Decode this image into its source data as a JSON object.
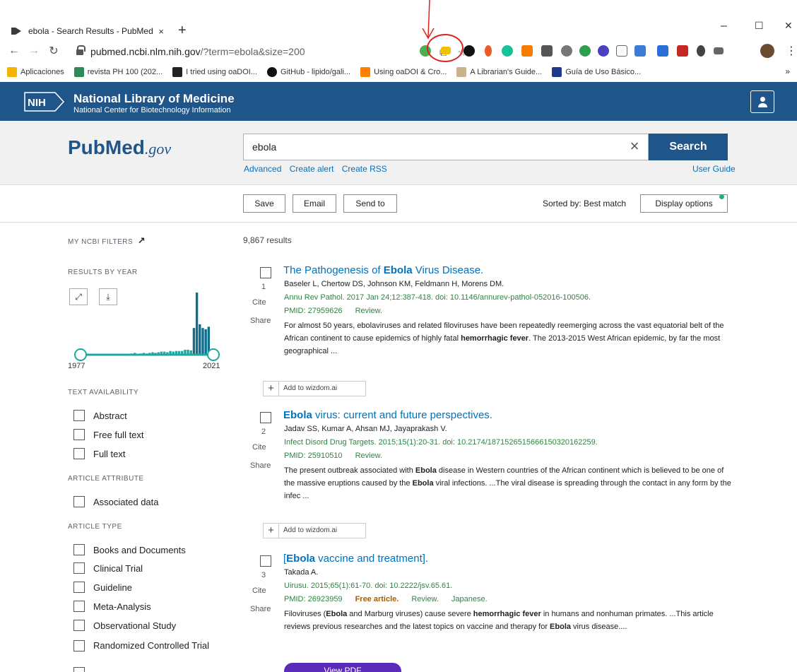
{
  "browser": {
    "tab_title": "ebola - Search Results - PubMed",
    "tab_close": "×",
    "new_tab": "+",
    "win_min": "–",
    "win_max": "☐",
    "win_close": "✕",
    "url_host": "pubmed.ncbi.nlm.nih.gov",
    "url_rest": "/?term=ebola&size=200",
    "back": "←",
    "forward": "→",
    "reload": "↻",
    "omni_translate": "⧉",
    "omni_star": "☆",
    "kebab": "⋮",
    "bookmarks": [
      {
        "label": "Aplicaciones",
        "color": "#f4b400"
      },
      {
        "label": "revista PH 100 (202...",
        "color": "#2e8b57"
      },
      {
        "label": "I tried using oaDOI...",
        "color": "#222222"
      },
      {
        "label": "GitHub - lipido/gali...",
        "color": "#111111"
      },
      {
        "label": "Using oaDOI & Cro...",
        "color": "#ff7f00"
      },
      {
        "label": "A Librarian's Guide...",
        "color": "#c9b38a"
      },
      {
        "label": "Guía de Uso Básico...",
        "color": "#1e3a8a"
      }
    ],
    "bookmarks_more": "»"
  },
  "nih": {
    "logo": "NIH",
    "title": "National Library of Medicine",
    "subtitle": "National Center for Biotechnology Information"
  },
  "search": {
    "logo_main": "PubMed",
    "logo_gov": ".gov",
    "query": "ebola",
    "clear": "×",
    "button": "Search",
    "links": [
      "Advanced",
      "Create alert",
      "Create RSS"
    ],
    "user_guide": "User Guide"
  },
  "actions": {
    "save": "Save",
    "email": "Email",
    "send_to": "Send to",
    "sorted": "Sorted by: Best match",
    "display": "Display options"
  },
  "sidebar": {
    "my_ncbi": "MY NCBI FILTERS",
    "my_ncbi_icon": "↗",
    "results_by_year": "RESULTS BY YEAR",
    "expand_icon": "⤢",
    "download_icon": "⤓",
    "year_start": "1977",
    "year_end": "2021",
    "text_availability": "TEXT AVAILABILITY",
    "text_filters": [
      "Abstract",
      "Free full text",
      "Full text"
    ],
    "article_attribute": "ARTICLE ATTRIBUTE",
    "attr_filters": [
      "Associated data"
    ],
    "article_type": "ARTICLE TYPE",
    "type_filters": [
      "Books and Documents",
      "Clinical Trial",
      "Guideline",
      "Meta-Analysis",
      "Observational Study",
      "Randomized Controlled Trial"
    ]
  },
  "results": {
    "count": "9,867 results",
    "cite": "Cite",
    "share": "Share",
    "wizdom": "Add to wizdom.ai",
    "wizdom_plus": "+",
    "items": [
      {
        "num": "1",
        "title_pre": "The Pathogenesis of ",
        "title_bold": "Ebola",
        "title_post": " Virus Disease.",
        "authors": "Baseler L, Chertow DS, Johnson KM, Feldmann H, Morens DM.",
        "citation": "Annu Rev Pathol. 2017 Jan 24;12:387-418. doi: 10.1146/annurev-pathol-052016-100506.",
        "pmid": "PMID: 27959626",
        "free": "",
        "type": "Review.",
        "lang": "",
        "snip1": "For almost 50 years, ebolaviruses and related filoviruses have been repeatedly reemerging across the vast equatorial belt of the African continent to cause epidemics of highly fatal ",
        "snip1b": "hemorrhagic fever",
        "snip1c": ". The 2013-2015 West African epidemic, by far the most geographical ..."
      },
      {
        "num": "2",
        "title_pre": "",
        "title_bold": "Ebola",
        "title_post": " virus: current and future perspectives.",
        "authors": "Jadav SS, Kumar A, Ahsan MJ, Jayaprakash V.",
        "citation": "Infect Disord Drug Targets. 2015;15(1):20-31. doi: 10.2174/1871526515666150320162259.",
        "pmid": "PMID: 25910510",
        "free": "",
        "type": "Review.",
        "lang": "",
        "snip_a": "The present outbreak associated with ",
        "snip_b": "Ebola",
        "snip_c": " disease in Western countries of the African continent which is believed to be one of the massive eruptions caused by the ",
        "snip_d": "Ebola",
        "snip_e": " viral infections. ...The viral disease is spreading through the contact in any form by the infec ..."
      },
      {
        "num": "3",
        "title_pre": "[",
        "title_bold": "Ebola",
        "title_post": " vaccine and treatment].",
        "authors": "Takada A.",
        "citation": "Uirusu. 2015;65(1):61-70. doi: 10.2222/jsv.65.61.",
        "pmid": "PMID: 26923959",
        "free": "Free article.",
        "type": "Review.",
        "lang": "Japanese.",
        "s1": "Filoviruses (",
        "s2": "Ebola",
        "s3": " and Marburg viruses) cause severe ",
        "s4": "hemorrhagic fever",
        "s5": " in humans and nonhuman primates. ...This article reviews previous researches and the latest topics on vaccine and therapy for ",
        "s6": "Ebola",
        "s7": " virus disease...."
      }
    ],
    "view_pdf": "View PDF"
  },
  "chart_data": {
    "type": "bar",
    "xlim": [
      1977,
      2021
    ],
    "values": [
      0,
      0,
      0,
      1,
      0,
      0,
      0,
      0,
      0,
      0,
      0,
      1,
      0,
      1,
      0,
      1,
      1,
      2,
      3,
      1,
      2,
      3,
      2,
      3,
      4,
      3,
      4,
      5,
      5,
      4,
      6,
      5,
      6,
      6,
      6,
      8,
      8,
      7,
      43,
      100,
      49,
      43,
      41,
      45,
      6
    ],
    "accent": "#20a89e"
  }
}
